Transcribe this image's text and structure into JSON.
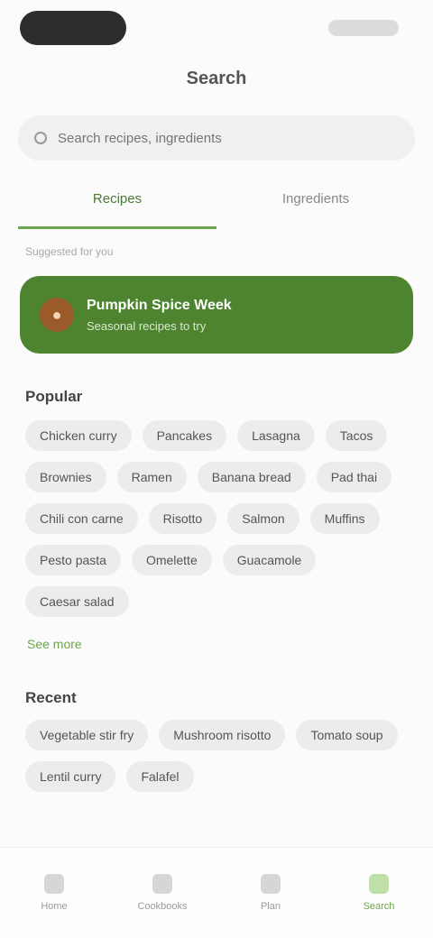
{
  "page": {
    "title": "Search"
  },
  "search": {
    "placeholder": "Search recipes, ingredients",
    "value": ""
  },
  "tabs": [
    {
      "label": "Recipes",
      "active": true
    },
    {
      "label": "Ingredients",
      "active": false
    }
  ],
  "section_caption": "Suggested for you",
  "banner": {
    "title": "Pumpkin Spice Week",
    "subtitle": "Seasonal recipes to try",
    "icon": "pumpkin-icon"
  },
  "popular": {
    "title": "Popular",
    "chips": [
      "Chicken curry",
      "Pancakes",
      "Lasagna",
      "Tacos",
      "Brownies",
      "Ramen",
      "Banana bread",
      "Pad thai",
      "Chili con carne",
      "Risotto",
      "Salmon",
      "Muffins",
      "Pesto pasta",
      "Omelette",
      "Guacamole",
      "Caesar salad"
    ],
    "see_more": "See more"
  },
  "recent": {
    "title": "Recent",
    "chips": [
      "Vegetable stir fry",
      "Mushroom risotto",
      "Tomato soup",
      "Lentil curry",
      "Falafel"
    ]
  },
  "bottom_nav": [
    {
      "label": "Home",
      "icon": "home-icon",
      "active": false
    },
    {
      "label": "Cookbooks",
      "icon": "book-icon",
      "active": false
    },
    {
      "label": "Plan",
      "icon": "calendar-icon",
      "active": false
    },
    {
      "label": "Search",
      "icon": "search-icon",
      "active": true
    }
  ],
  "colors": {
    "accent": "#6fa54d",
    "banner": "#4e8430"
  }
}
